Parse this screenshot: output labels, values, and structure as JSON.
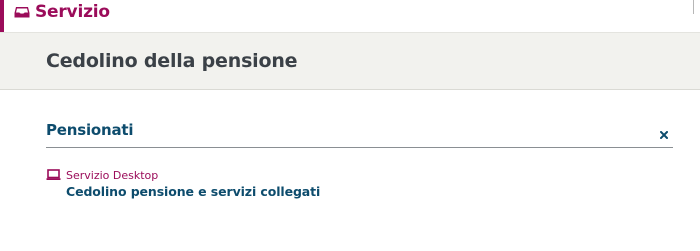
{
  "header": {
    "service_label": "Servizio",
    "icon": "inbox-icon",
    "accent_color": "#9b0c5a"
  },
  "page": {
    "title": "Cedolino della pensione"
  },
  "section": {
    "title": "Pensionati",
    "close_icon": "close-icon",
    "title_color": "#0d4c6d"
  },
  "service": {
    "kind_label": "Servizio Desktop",
    "kind_icon": "laptop-icon",
    "link_label": "Cedolino pensione e servizi collegati"
  }
}
